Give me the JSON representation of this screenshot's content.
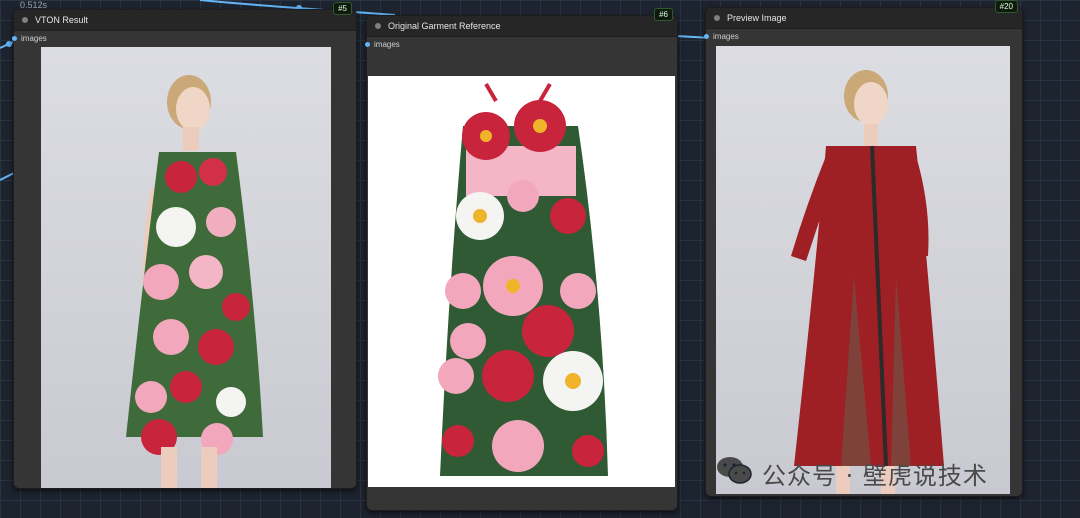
{
  "execution_time": "0.512s",
  "nodes": [
    {
      "title": "VTON Result",
      "id_badge": "#5",
      "slot_label": "images"
    },
    {
      "title": "Original Garment Reference",
      "id_badge": "#6",
      "slot_label": "images"
    },
    {
      "title": "Preview Image",
      "id_badge": "#20",
      "slot_label": "images"
    }
  ],
  "watermark": {
    "text": "公众号 · 壁虎说技术",
    "icon": "wechat-icon"
  },
  "colors": {
    "canvas": "#1d2430",
    "node": "#353535",
    "wire": "#64b5f6",
    "dress_red": "#b3203a",
    "dress_pink": "#f2a7bd"
  }
}
